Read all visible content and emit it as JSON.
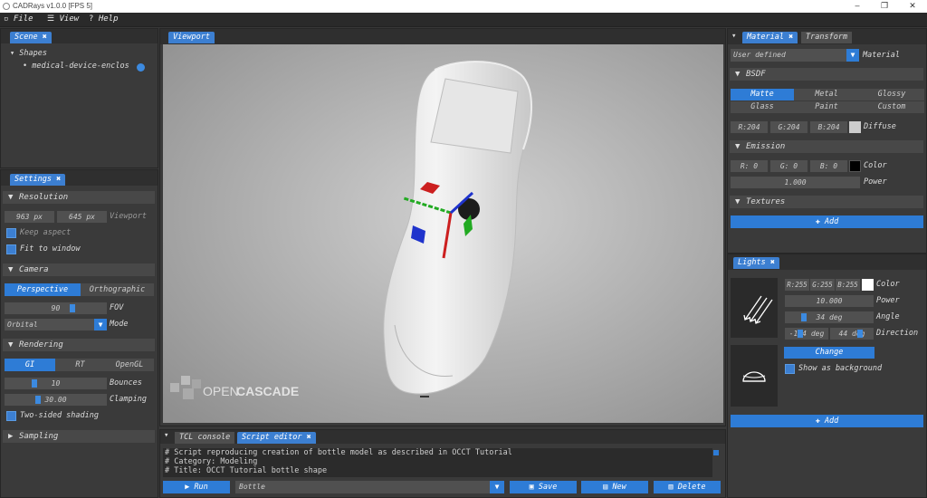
{
  "window": {
    "title": "CADRays v1.0.0 [FPS 5]",
    "minimize": "–",
    "maximize": "❐",
    "close": "✕"
  },
  "menu": {
    "file": "File",
    "view": "View",
    "help": "Help"
  },
  "scene": {
    "tab": "Scene",
    "shapes_header": "Shapes",
    "item": "medical-device-enclos"
  },
  "settings": {
    "tab": "Settings",
    "resolution": {
      "header": "Resolution",
      "width": "963 px",
      "height": "645 px",
      "label": "Viewport",
      "keep_aspect": "Keep aspect",
      "fit_window": "Fit to window"
    },
    "camera": {
      "header": "Camera",
      "perspective": "Perspective",
      "orthographic": "Orthographic",
      "fov": "90",
      "fov_label": "FOV",
      "mode": "Orbital",
      "mode_label": "Mode"
    },
    "rendering": {
      "header": "Rendering",
      "gi": "GI",
      "rt": "RT",
      "opengl": "OpenGL",
      "bounces": "10",
      "bounces_label": "Bounces",
      "clamping": "30.00",
      "clamping_label": "Clamping",
      "two_sided": "Two-sided shading"
    },
    "sampling": {
      "header": "Sampling"
    }
  },
  "viewport": {
    "tab": "Viewport",
    "logo_a": "OPEN",
    "logo_b": "CASCADE"
  },
  "console": {
    "tab_tcl": "TCL console",
    "tab_script": "Script editor",
    "lines": [
      "# Script reproducing creation of bottle model as described in OCCT Tutorial",
      "# Category: Modeling",
      "# Title: OCCT Tutorial bottle shape"
    ],
    "run": "Run",
    "script_name": "Bottle",
    "save": "Save",
    "new": "New",
    "delete": "Delete"
  },
  "material": {
    "tab_material": "Material",
    "tab_transform": "Transform",
    "preset": "User defined",
    "preset_label": "Material",
    "bsdf_header": "BSDF",
    "types": [
      "Matte",
      "Metal",
      "Glossy",
      "Glass",
      "Paint",
      "Custom"
    ],
    "diffuse": {
      "r": "R:204",
      "g": "G:204",
      "b": "B:204",
      "label": "Diffuse",
      "color": "#cccccc"
    },
    "emission_header": "Emission",
    "emission": {
      "r": "R:  0",
      "g": "G:  0",
      "b": "B:  0",
      "label": "Color",
      "color": "#000000",
      "power": "1.000",
      "power_label": "Power"
    },
    "textures_header": "Textures",
    "add": "Add"
  },
  "lights": {
    "tab": "Lights",
    "light1": {
      "r": "R:255",
      "g": "G:255",
      "b": "B:255",
      "color_label": "Color",
      "color": "#ffffff",
      "power": "10.000",
      "power_label": "Power",
      "angle": "34 deg",
      "angle_label": "Angle",
      "dir1": "-104 deg",
      "dir2": "44 deg",
      "dir_label": "Direction"
    },
    "change": "Change",
    "show_bg": "Show as background",
    "add": "Add"
  },
  "colors": {
    "accent": "#2e7cd6",
    "panel": "#3a3a3a"
  }
}
